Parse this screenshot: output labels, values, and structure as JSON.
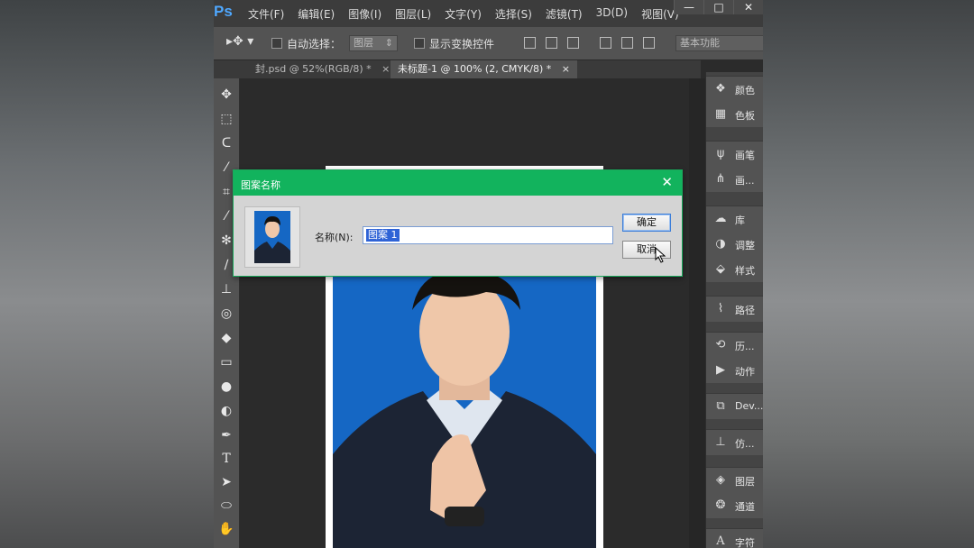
{
  "app": {
    "logo": "Ps",
    "menu": [
      "文件(F)",
      "编辑(E)",
      "图像(I)",
      "图层(L)",
      "文字(Y)",
      "选择(S)",
      "滤镜(T)",
      "3D(D)",
      "视图(V)"
    ],
    "window_controls": [
      "—",
      "□",
      "✕"
    ]
  },
  "options": {
    "auto_select_label": "自动选择：",
    "auto_select_value": "图层",
    "show_transform_label": "显示变换控件",
    "workspace_value": "基本功能"
  },
  "tabs": [
    {
      "label": "封.psd @ 52%(RGB/8) *",
      "close": "×"
    },
    {
      "label": "未标题-1 @ 100% (2, CMYK/8) *",
      "close": "×"
    }
  ],
  "right_panel": [
    {
      "icon": "color-icon",
      "label": "颜色"
    },
    {
      "icon": "swatches-icon",
      "label": "色板"
    },
    {
      "icon": "brush-icon",
      "label": "画笔"
    },
    {
      "icon": "brush-presets-icon",
      "label": "画..."
    },
    {
      "icon": "libraries-icon",
      "label": "库"
    },
    {
      "icon": "adjustments-icon",
      "label": "调整"
    },
    {
      "icon": "styles-icon",
      "label": "样式"
    },
    {
      "icon": "paths-icon",
      "label": "路径"
    },
    {
      "icon": "history-icon",
      "label": "历..."
    },
    {
      "icon": "actions-icon",
      "label": "动作"
    },
    {
      "icon": "device-preview-icon",
      "label": "Dev..."
    },
    {
      "icon": "clone-source-icon",
      "label": "仿..."
    },
    {
      "icon": "layers-icon",
      "label": "图层"
    },
    {
      "icon": "channels-icon",
      "label": "通道"
    },
    {
      "icon": "character-icon",
      "label": "字符"
    }
  ],
  "dialog": {
    "title": "图案名称",
    "name_label": "名称(N):",
    "name_value": "图案 1",
    "ok_label": "确定",
    "cancel_label": "取消",
    "close_glyph": "✕"
  },
  "colors": {
    "dialog_title_bar": "#12b35d",
    "photo_background": "#1567c4",
    "selection_highlight": "#2f63d6"
  }
}
